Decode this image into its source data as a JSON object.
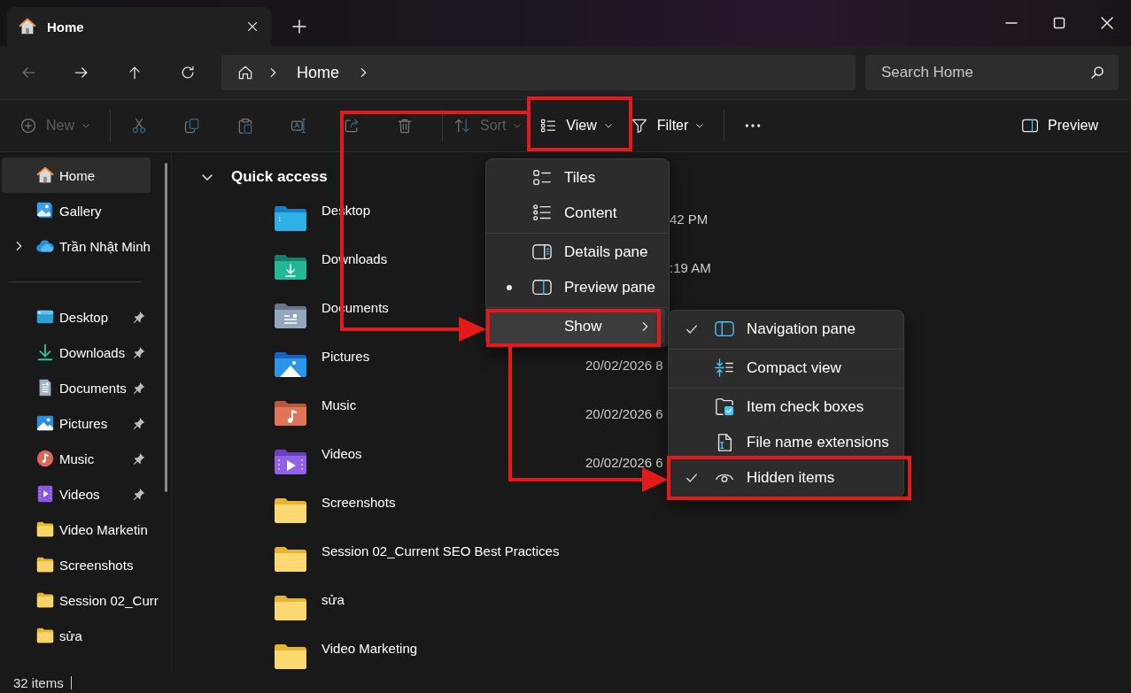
{
  "tabs": [
    {
      "title": "Home",
      "selected": true
    }
  ],
  "nav_buttons": [
    {
      "kind": "back",
      "disabled": true
    },
    {
      "kind": "forward",
      "disabled": false
    },
    {
      "kind": "up",
      "disabled": false
    },
    {
      "kind": "refresh",
      "disabled": false
    }
  ],
  "address_bar": {
    "breadcrumb": [
      "Home"
    ]
  },
  "search": {
    "placeholder": "Search Home"
  },
  "toolbar": {
    "items": [
      {
        "kind": "new",
        "label": "New",
        "disabled": true
      },
      {
        "kind": "separator"
      },
      {
        "kind": "cut",
        "disabled": true
      },
      {
        "kind": "copy",
        "disabled": true
      },
      {
        "kind": "paste",
        "disabled": true
      },
      {
        "kind": "rename",
        "disabled": true
      },
      {
        "kind": "share",
        "disabled": true
      },
      {
        "kind": "delete",
        "disabled": true
      },
      {
        "kind": "separator"
      },
      {
        "kind": "sort",
        "label": "Sort",
        "disabled": true
      },
      {
        "kind": "view",
        "label": "View",
        "disabled": false
      },
      {
        "kind": "filter",
        "label": "Filter",
        "disabled": false
      },
      {
        "kind": "separator"
      },
      {
        "kind": "more",
        "disabled": false
      }
    ],
    "right": [
      {
        "kind": "preview",
        "label": "Preview",
        "disabled": false
      }
    ]
  },
  "sidebar": {
    "groups": [
      [
        {
          "label": "Home",
          "kind": "home",
          "selected": true
        },
        {
          "label": "Gallery",
          "kind": "gallery",
          "selected": false
        },
        {
          "label": "Trần Nhật Minh",
          "kind": "cloud",
          "selected": false,
          "expanded": false
        }
      ],
      [
        {
          "label": "Desktop",
          "kind": "desktop",
          "selected": false,
          "pinned": true
        },
        {
          "label": "Downloads",
          "kind": "downloads",
          "selected": false,
          "pinned": true
        },
        {
          "label": "Documents",
          "kind": "documents",
          "selected": false,
          "pinned": true
        },
        {
          "label": "Pictures",
          "kind": "pictures",
          "selected": false,
          "pinned": true
        },
        {
          "label": "Music",
          "kind": "music",
          "selected": false,
          "pinned": true
        },
        {
          "label": "Videos",
          "kind": "videos",
          "selected": false,
          "pinned": true
        },
        {
          "label": "Video Marketin",
          "kind": "folder",
          "selected": false,
          "pinned": false
        },
        {
          "label": "Screenshots",
          "kind": "folder",
          "selected": false,
          "pinned": false
        },
        {
          "label": "Session 02_Curr",
          "kind": "folder",
          "selected": false,
          "pinned": false
        },
        {
          "label": "sửa",
          "kind": "folder",
          "selected": false,
          "pinned": false
        }
      ]
    ]
  },
  "content": {
    "section": {
      "title": "Quick access",
      "expanded": true
    },
    "items": [
      {
        "name": "Desktop",
        "kind": "desktop",
        "date": "42 PM"
      },
      {
        "name": "Downloads",
        "kind": "downloads",
        "date": ":19 AM"
      },
      {
        "name": "Documents",
        "kind": "documents"
      },
      {
        "name": "Pictures",
        "kind": "pictures",
        "date": "20/02/2026 8"
      },
      {
        "name": "Music",
        "kind": "music",
        "date": "20/02/2026 6"
      },
      {
        "name": "Videos",
        "kind": "videos",
        "date": "20/02/2026 6"
      },
      {
        "name": "Screenshots",
        "kind": "folder"
      },
      {
        "name": "Session 02_Current SEO Best Practices",
        "kind": "folder"
      },
      {
        "name": "sửa",
        "kind": "folder"
      },
      {
        "name": "Video Marketing",
        "kind": "folder"
      }
    ]
  },
  "view_menu": {
    "groups": [
      [
        {
          "label": "Tiles",
          "kind": "tiles",
          "selected": false
        },
        {
          "label": "Content",
          "kind": "content",
          "selected": false
        }
      ],
      [
        {
          "label": "Details pane",
          "kind": "details",
          "selected": false
        },
        {
          "label": "Preview pane",
          "kind": "preview",
          "selected": true
        }
      ],
      [
        {
          "label": "Show",
          "kind": "submenu",
          "expanded": true
        }
      ]
    ]
  },
  "show_submenu": {
    "groups": [
      [
        {
          "label": "Navigation pane",
          "kind": "navigation",
          "checked": true
        }
      ],
      [
        {
          "label": "Compact view",
          "kind": "compact",
          "checked": false
        }
      ],
      [
        {
          "label": "Item check boxes",
          "kind": "checkboxes",
          "checked": false
        },
        {
          "label": "File name extensions",
          "kind": "extensions",
          "checked": false
        },
        {
          "label": "Hidden items",
          "kind": "hidden",
          "checked": true
        }
      ]
    ]
  },
  "status_bar": {
    "count": "32 items"
  }
}
